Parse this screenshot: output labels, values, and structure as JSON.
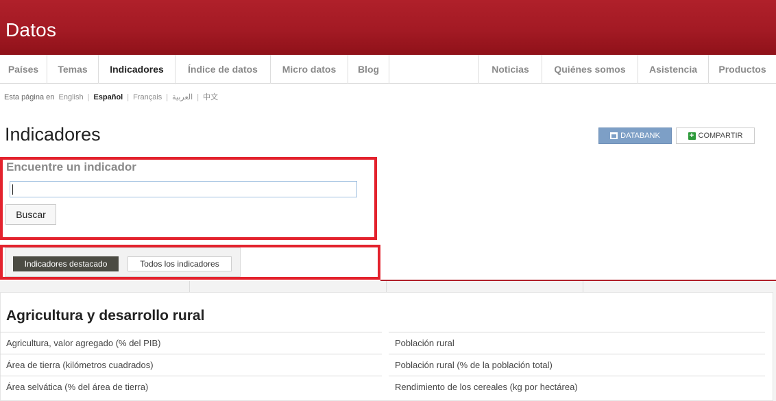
{
  "header": {
    "brand": "Datos"
  },
  "nav": {
    "items": [
      {
        "label": "Países"
      },
      {
        "label": "Temas"
      },
      {
        "label": "Indicadores"
      },
      {
        "label": "Índice de datos"
      },
      {
        "label": "Micro datos"
      },
      {
        "label": "Blog"
      },
      {
        "label": "Noticias"
      },
      {
        "label": "Quiénes somos"
      },
      {
        "label": "Asistencia"
      },
      {
        "label": "Productos"
      }
    ],
    "active": "Indicadores"
  },
  "language_bar": {
    "prefix": "Esta página en",
    "languages": [
      "English",
      "Español",
      "Français",
      "العربية",
      "中文"
    ],
    "current": "Español"
  },
  "page": {
    "title": "Indicadores"
  },
  "actions": {
    "databank_label": "DATABANK",
    "share_label": "COMPARTIR"
  },
  "search": {
    "title": "Encuentre un indicador",
    "input_value": "",
    "button_label": "Buscar"
  },
  "tabs": {
    "featured_label": "Indicadores destacado",
    "all_label": "Todos los indicadores",
    "active": "Indicadores destacado"
  },
  "section": {
    "title": "Agricultura y desarrollo rural",
    "left_items": [
      "Agricultura, valor agregado (% del PIB)",
      "Área de tierra (kilómetros cuadrados)",
      "Área selvática (% del área de tierra)"
    ],
    "right_items": [
      "Población rural",
      "Población rural (% de la población total)",
      "Rendimiento de los cereales (kg por hectárea)"
    ]
  },
  "colors": {
    "brand_red": "#a31a24",
    "highlight_red": "#e3222d",
    "databank_blue": "#7d9fc6",
    "share_green": "#2d9a3a",
    "tab_dark": "#4b4b43"
  }
}
